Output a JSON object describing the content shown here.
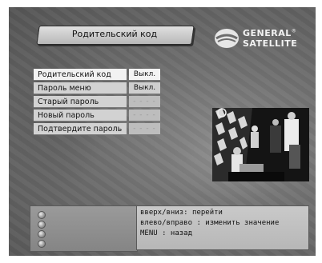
{
  "header": {
    "title": "Родительский код"
  },
  "logo": {
    "line1": "GENERAL",
    "reg": "®",
    "line2": "SATELLITE"
  },
  "menu": {
    "items": [
      {
        "label": "Родительский код",
        "value": "Выкл."
      },
      {
        "label": "Пароль меню",
        "value": "Выкл."
      },
      {
        "label": "Старый пароль",
        "value": "- - - -"
      },
      {
        "label": "Новый пароль",
        "value": "- - - -"
      },
      {
        "label": "Подтвердите пароль",
        "value": "- - - -"
      }
    ]
  },
  "help": {
    "lines": [
      "вверх/вниз: перейти",
      "влево/вправо : изменить значение",
      "MENU : назад"
    ]
  },
  "icons": [
    "circle-button-icon",
    "circle-button-icon",
    "circle-button-icon",
    "circle-button-icon"
  ]
}
